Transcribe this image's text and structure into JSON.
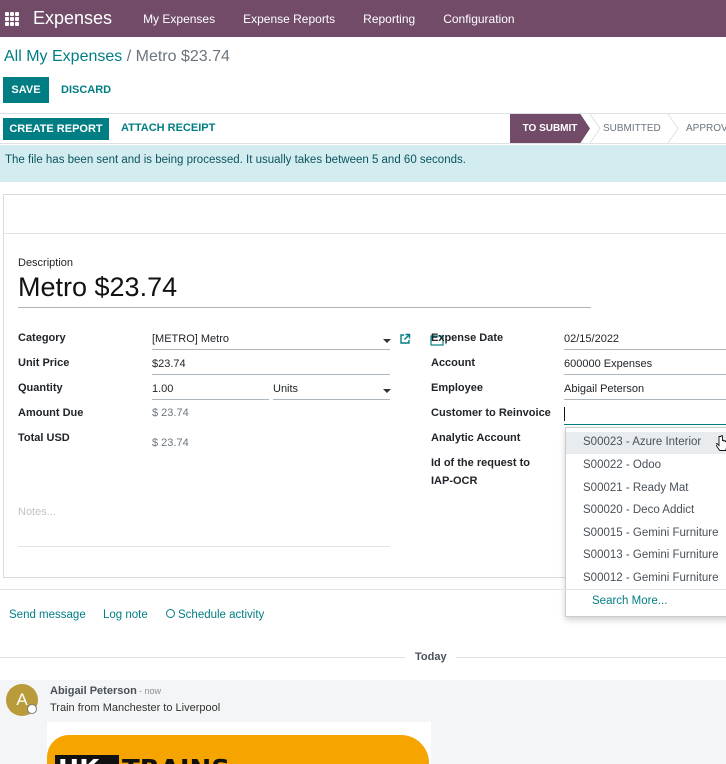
{
  "navbar": {
    "app_name": "Expenses",
    "menu": [
      "My Expenses",
      "Expense Reports",
      "Reporting",
      "Configuration"
    ]
  },
  "breadcrumb": {
    "parent": "All My Expenses",
    "separator": "/",
    "current": "Metro $23.74"
  },
  "actions": {
    "save": "SAVE",
    "discard": "DISCARD"
  },
  "statusbar": {
    "create_report": "CREATE REPORT",
    "attach_receipt": "ATTACH RECEIPT",
    "stages": [
      "TO SUBMIT",
      "SUBMITTED",
      "APPROV"
    ],
    "active_stage": "TO SUBMIT"
  },
  "alert": {
    "text": "The file has been sent and is being processed. It usually takes between 5 and 60 seconds."
  },
  "form": {
    "description_label": "Description",
    "description": "Metro $23.74",
    "left": {
      "category_label": "Category",
      "category": "[METRO] Metro",
      "unit_price_label": "Unit Price",
      "unit_price": "$23.74",
      "quantity_label": "Quantity",
      "quantity": "1.00",
      "uom": "Units",
      "amount_due_label": "Amount Due",
      "amount_due": "$ 23.74",
      "total_label": "Total USD",
      "total": "$ 23.74"
    },
    "right": {
      "expense_date_label": "Expense Date",
      "expense_date": "02/15/2022",
      "account_label": "Account",
      "account": "600000 Expenses",
      "employee_label": "Employee",
      "employee": "Abigail Peterson",
      "customer_label": "Customer to Reinvoice",
      "customer": "",
      "analytic_label": "Analytic Account",
      "iap_label_1": "Id of the request to",
      "iap_label_2": "IAP-OCR"
    },
    "notes_placeholder": "Notes..."
  },
  "dropdown": {
    "items": [
      "S00023 - Azure Interior",
      "S00022 - Odoo",
      "S00021 - Ready Mat",
      "S00020 - Deco Addict",
      "S00015 - Gemini Furniture",
      "S00013 - Gemini Furniture",
      "S00012 - Gemini Furniture"
    ],
    "highlighted_index": 0,
    "search_more": "Search More..."
  },
  "chatter": {
    "send_message": "Send message",
    "log_note": "Log note",
    "schedule_activity": "Schedule activity",
    "today": "Today",
    "message": {
      "avatar_letter": "A",
      "author": "Abigail Peterson",
      "when": "- now",
      "body": "Train from Manchester to Liverpool",
      "attachment_logo": "UK TRAINS"
    }
  },
  "colors": {
    "brand": "#714B67",
    "accent": "#017E84",
    "alert_bg": "#d2ecef"
  }
}
